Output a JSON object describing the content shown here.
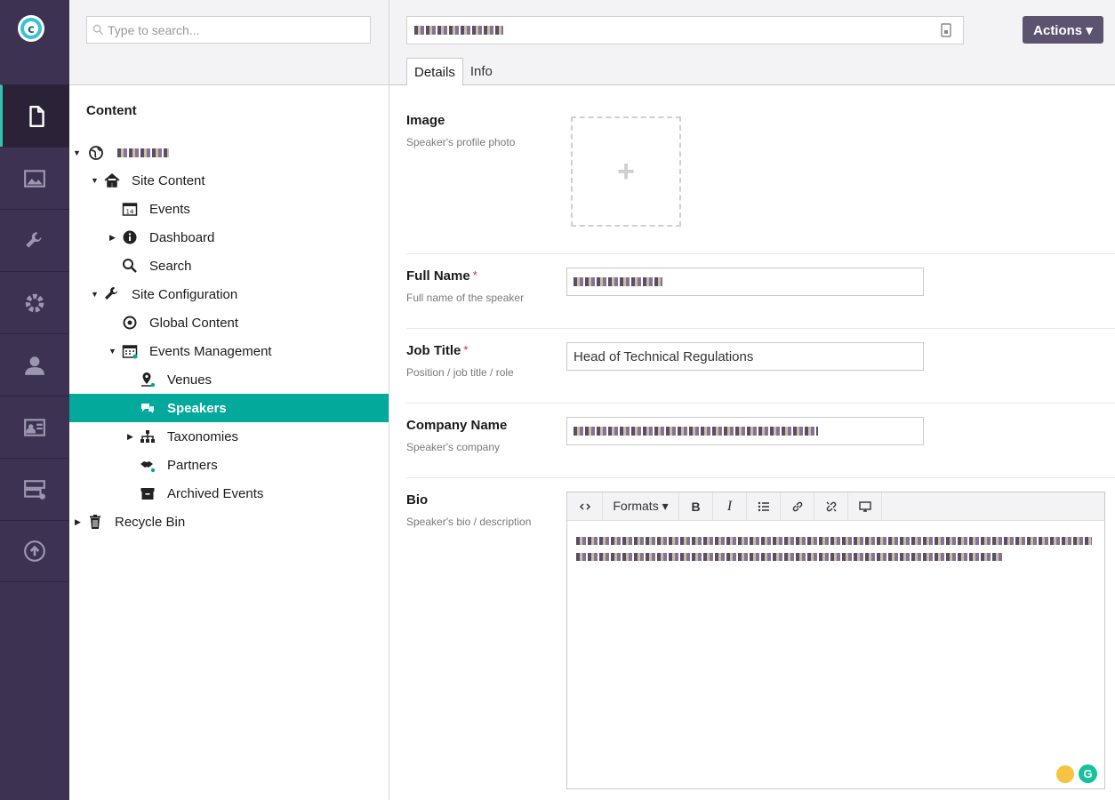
{
  "app": {
    "logo": "umbraco-logo-icon",
    "accent": "#03a99c",
    "rail_bg": "#3d3251"
  },
  "rail": {
    "items": [
      {
        "name": "content",
        "icon": "document-icon",
        "active": true
      },
      {
        "name": "media",
        "icon": "image-icon",
        "active": false
      },
      {
        "name": "settings",
        "icon": "wrench-icon",
        "active": false
      },
      {
        "name": "developer",
        "icon": "gear-icon",
        "active": false
      },
      {
        "name": "users",
        "icon": "user-icon",
        "active": false
      },
      {
        "name": "members",
        "icon": "id-card-icon",
        "active": false
      },
      {
        "name": "forms",
        "icon": "form-icon",
        "active": false
      },
      {
        "name": "deploy",
        "icon": "cloud-upload-icon",
        "active": false
      }
    ]
  },
  "tree": {
    "search_placeholder": "Type to search...",
    "title": "Content",
    "nodes": [
      {
        "label": "Site Content"
      },
      {
        "label": "Events"
      },
      {
        "label": "Dashboard"
      },
      {
        "label": "Search"
      },
      {
        "label": "Site Configuration"
      },
      {
        "label": "Global Content"
      },
      {
        "label": "Events Management"
      },
      {
        "label": "Venues"
      },
      {
        "label": "Speakers"
      },
      {
        "label": "Taxonomies"
      },
      {
        "label": "Partners"
      },
      {
        "label": "Archived Events"
      },
      {
        "label": "Recycle Bin"
      }
    ]
  },
  "editor": {
    "actions_label": "Actions ▾",
    "tabs": [
      {
        "label": "Details"
      },
      {
        "label": "Info"
      }
    ],
    "fields": {
      "image": {
        "label": "Image",
        "desc": "Speaker's profile photo"
      },
      "full_name": {
        "label": "Full Name",
        "desc": "Full name of the speaker",
        "required": "*"
      },
      "job_title": {
        "label": "Job Title",
        "desc": "Position / job title / role",
        "required": "*",
        "value": "Head of Technical Regulations"
      },
      "company": {
        "label": "Company Name",
        "desc": "Speaker's company"
      },
      "bio": {
        "label": "Bio",
        "desc": "Speaker's bio / description"
      }
    },
    "rte_toolbar": {
      "formats_label": "Formats ▾",
      "bold": "B",
      "italic": "I"
    },
    "grammarly": "G"
  }
}
